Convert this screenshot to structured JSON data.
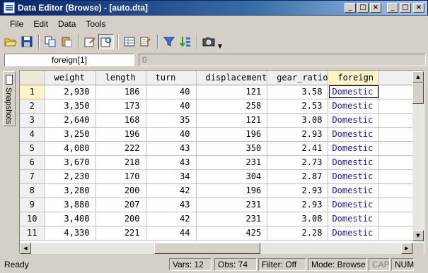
{
  "window": {
    "title": "Data Editor (Browse) - [auto.dta]",
    "controls": [
      "_",
      "□",
      "×",
      "_",
      "□",
      "×"
    ]
  },
  "menu": [
    "File",
    "Edit",
    "Data",
    "Tools"
  ],
  "toolbar": {
    "icons": [
      "open-icon",
      "save-icon",
      "copy-icon",
      "paste-icon",
      "edit-mode-icon",
      "browse-mode-icon",
      "variables-manager-icon",
      "properties-icon",
      "filter-icon",
      "sort-icon",
      "snapshot-icon"
    ]
  },
  "editbar": {
    "cell_ref": "foreign[1]",
    "cell_value": "0"
  },
  "sidetab": {
    "label": "Snapshots"
  },
  "grid": {
    "columns": [
      "weight",
      "length",
      "turn",
      "displacement",
      "gear_ratio",
      "foreign"
    ],
    "rows": [
      {
        "n": "1",
        "weight": "2,930",
        "length": "186",
        "turn": "40",
        "displacement": "121",
        "gear_ratio": "3.58",
        "foreign": "Domestic"
      },
      {
        "n": "2",
        "weight": "3,350",
        "length": "173",
        "turn": "40",
        "displacement": "258",
        "gear_ratio": "2.53",
        "foreign": "Domestic"
      },
      {
        "n": "3",
        "weight": "2,640",
        "length": "168",
        "turn": "35",
        "displacement": "121",
        "gear_ratio": "3.08",
        "foreign": "Domestic"
      },
      {
        "n": "4",
        "weight": "3,250",
        "length": "196",
        "turn": "40",
        "displacement": "196",
        "gear_ratio": "2.93",
        "foreign": "Domestic"
      },
      {
        "n": "5",
        "weight": "4,080",
        "length": "222",
        "turn": "43",
        "displacement": "350",
        "gear_ratio": "2.41",
        "foreign": "Domestic"
      },
      {
        "n": "6",
        "weight": "3,670",
        "length": "218",
        "turn": "43",
        "displacement": "231",
        "gear_ratio": "2.73",
        "foreign": "Domestic"
      },
      {
        "n": "7",
        "weight": "2,230",
        "length": "170",
        "turn": "34",
        "displacement": "304",
        "gear_ratio": "2.87",
        "foreign": "Domestic"
      },
      {
        "n": "8",
        "weight": "3,280",
        "length": "200",
        "turn": "42",
        "displacement": "196",
        "gear_ratio": "2.93",
        "foreign": "Domestic"
      },
      {
        "n": "9",
        "weight": "3,880",
        "length": "207",
        "turn": "43",
        "displacement": "231",
        "gear_ratio": "2.93",
        "foreign": "Domestic"
      },
      {
        "n": "10",
        "weight": "3,400",
        "length": "200",
        "turn": "42",
        "displacement": "231",
        "gear_ratio": "3.08",
        "foreign": "Domestic"
      },
      {
        "n": "11",
        "weight": "4,330",
        "length": "221",
        "turn": "44",
        "displacement": "425",
        "gear_ratio": "2.28",
        "foreign": "Domestic"
      }
    ],
    "selected_row": "1",
    "selected_column": "foreign"
  },
  "status": {
    "ready": "Ready",
    "vars": "Vars: 12",
    "obs": "Obs: 74",
    "filter": "Filter: Off",
    "mode": "Mode: Browse",
    "cap": "CAP",
    "num": "NUM"
  },
  "colors": {
    "titlebar_start": "#0a246a",
    "label_text": "#1a1aa8",
    "selected_header": "#fff4c8"
  }
}
